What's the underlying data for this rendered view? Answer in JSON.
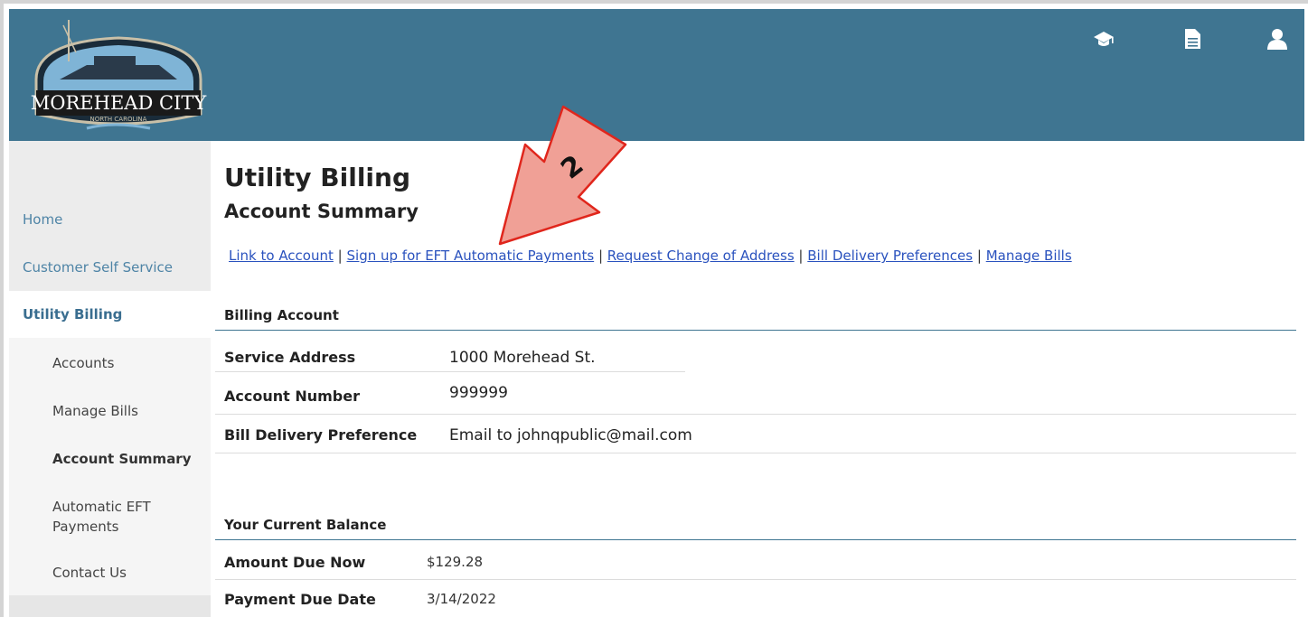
{
  "header": {
    "logo_text": "MOREHEAD CITY",
    "logo_subtext": "NORTH CAROLINA",
    "icons": [
      "graduation-cap-icon",
      "document-icon",
      "user-icon"
    ]
  },
  "sidebar": {
    "items": [
      {
        "label": "Home"
      },
      {
        "label": "Customer Self Service"
      },
      {
        "label": "Utility Billing"
      }
    ],
    "subitems": [
      {
        "label": "Accounts"
      },
      {
        "label": "Manage Bills"
      },
      {
        "label": "Account Summary"
      },
      {
        "label": "Automatic EFT Payments"
      },
      {
        "label": "Contact Us"
      }
    ]
  },
  "main": {
    "title": "Utility Billing",
    "subtitle": "Account Summary",
    "links": [
      "Link to Account",
      "Sign up for EFT Automatic Payments",
      "Request Change of Address",
      "Bill Delivery Preferences",
      "Manage Bills"
    ],
    "billing_account": {
      "heading": "Billing Account",
      "rows": [
        {
          "label": "Service Address",
          "value": "1000 Morehead St."
        },
        {
          "label": "Account Number",
          "value": "999999"
        },
        {
          "label": "Bill Delivery Preference",
          "value": "Email to johnqpublic@mail.com"
        }
      ]
    },
    "balance": {
      "heading": "Your Current Balance",
      "rows": [
        {
          "label": "Amount Due Now",
          "value": "$129.28"
        },
        {
          "label": "Payment Due Date",
          "value": "3/14/2022"
        }
      ]
    }
  },
  "annotation": {
    "number": "2",
    "color": "#f0a096",
    "stroke": "#e0261c"
  },
  "colors": {
    "header": "#3f7591",
    "link": "#2a52be",
    "nav": "#4e84a6"
  }
}
